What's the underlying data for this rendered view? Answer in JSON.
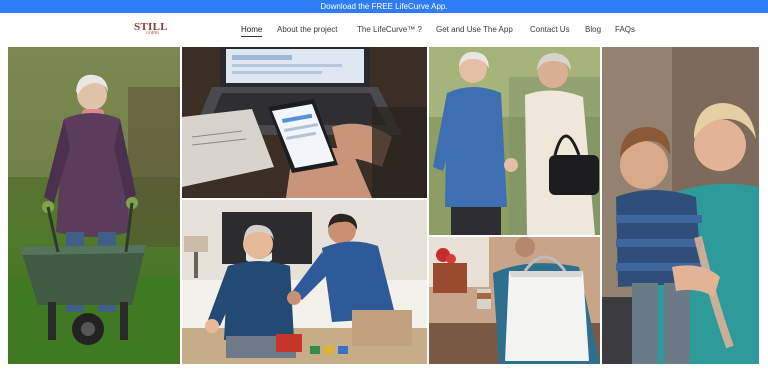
{
  "banner": {
    "text": "Download the FREE LifeCurve App."
  },
  "logo": {
    "main": "STILL",
    "sub": "GOING"
  },
  "nav": {
    "items": [
      {
        "label": "Home"
      },
      {
        "label": "About the project"
      },
      {
        "label": "The LifeCurve™ ?"
      },
      {
        "label": "Get and Use The App"
      },
      {
        "label": "Contact Us"
      },
      {
        "label": "Blog"
      },
      {
        "label": "FAQs"
      }
    ]
  },
  "colors": {
    "banner": "#2f7df6",
    "brand": "#8a3b2c",
    "nav_text": "#3a3a3a"
  }
}
